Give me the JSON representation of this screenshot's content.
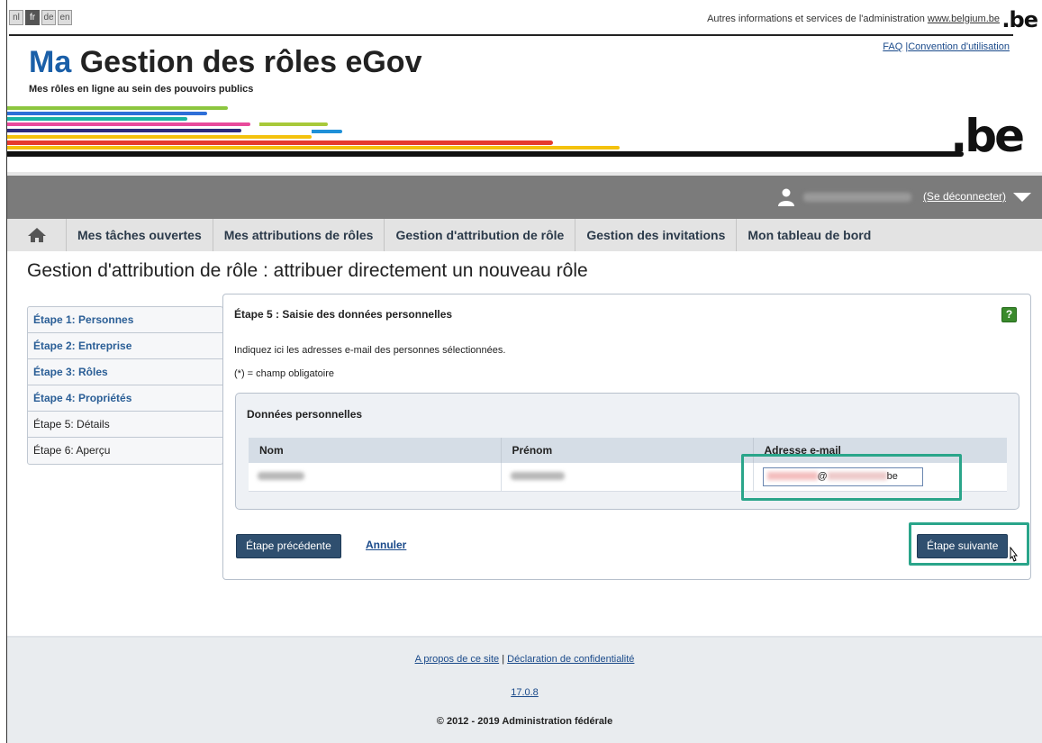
{
  "languages": [
    {
      "code": "nl",
      "active": false
    },
    {
      "code": "fr",
      "active": true
    },
    {
      "code": "de",
      "active": false
    },
    {
      "code": "en",
      "active": false
    }
  ],
  "top_info": {
    "text": "Autres informations et services de l'administration",
    "link": "www.belgium.be",
    "be_logo": ".be"
  },
  "top_links": {
    "faq": "FAQ",
    "sep": "|",
    "convention": "Convention d'utilisation"
  },
  "brand": {
    "ma": "Ma",
    "rest": "Gestion des rôles eGov",
    "tagline": "Mes rôles en ligne au sein des pouvoirs publics",
    "be_logo": ".be"
  },
  "stripe_colors": [
    "#8cc63f",
    "#2e6fd8",
    "#1ab3a6",
    "#e84a9b",
    "#a8c93a",
    "#1e90d8",
    "#2b2b7b",
    "#f4c20d",
    "#e63b2e",
    "#111111"
  ],
  "user_bar": {
    "logout": "(Se déconnecter)"
  },
  "nav": {
    "items": [
      "Mes tâches ouvertes",
      "Mes attributions de rôles",
      "Gestion d'attribution de rôle",
      "Gestion des invitations",
      "Mon tableau de bord"
    ]
  },
  "page_title": "Gestion d'attribution de rôle : attribuer directement un nouveau rôle",
  "steps": [
    {
      "label": "Étape 1: Personnes",
      "done": true
    },
    {
      "label": "Étape 2: Entreprise",
      "done": true
    },
    {
      "label": "Étape 3: Rôles",
      "done": true
    },
    {
      "label": "Étape 4: Propriétés",
      "done": true
    },
    {
      "label": "Étape 5: Détails",
      "done": false
    },
    {
      "label": "Étape 6: Aperçu",
      "done": false
    }
  ],
  "panel": {
    "title": "Étape 5 : Saisie des données personnelles",
    "help": "?",
    "instruction": "Indiquez ici les adresses e-mail des personnes sélectionnées.",
    "required_note": "(*) = champ obligatoire",
    "section_title": "Données personnelles",
    "table": {
      "headers": [
        "Nom",
        "Prénom",
        "Adresse e-mail"
      ],
      "email_at": "@",
      "email_suffix": "be"
    },
    "buttons": {
      "previous": "Étape précédente",
      "cancel": "Annuler",
      "next": "Étape suivante"
    }
  },
  "footer": {
    "about": "A propos de ce site",
    "sep": "|",
    "privacy": "Déclaration de confidentialité",
    "version": "17.0.8",
    "copyright": "© 2012 - 2019 Administration fédérale"
  },
  "colors": {
    "brand_blue": "#1a5fa8",
    "button": "#2f4f6f",
    "highlight": "#2aa58a",
    "userbar": "#7b7b7b"
  }
}
